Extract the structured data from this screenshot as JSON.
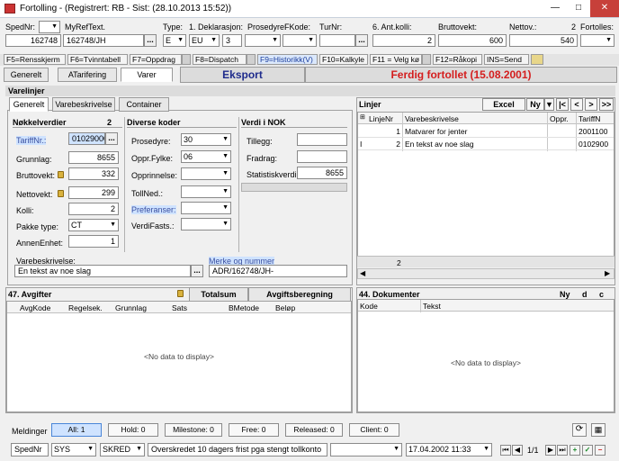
{
  "window": {
    "title": "Fortolling - (Registrert: RB - Sist: (28.10.2013 15:52))",
    "min_glyph": "—",
    "max_glyph": "□",
    "close_glyph": "✕"
  },
  "header": {
    "labels": {
      "spednr": "SpedNr:",
      "myref": "MyRefText.",
      "type": "Type:",
      "deklarasjon": "1. Deklarasjon:",
      "prosedyre": "Prosedyre:",
      "fkode": "FKode:",
      "turnr": "TurNr:",
      "antkolli": "6. Ant.kolli:",
      "bruttovekt": "Bruttovekt:",
      "nettov": "Nettov.:",
      "fortolles": "Fortolles:",
      "fortolles_num": "2"
    },
    "values": {
      "spednr": "162748",
      "myref": "162748/JH",
      "type": "E",
      "dekl_a": "EU",
      "dekl_b": "3",
      "antkolli": "2",
      "bruttovekt": "600",
      "nettov": "540"
    },
    "ellipsis": "..."
  },
  "fkeys": [
    "F5=Rensskjerm",
    "F6=Tvinntabell",
    "F7=Oppdrag",
    "F8=Dispatch",
    "F9=Historikk(V)",
    "F10=Kalkyle",
    "F11 = Velg kø",
    "F12=Råkopi",
    "INS=Send"
  ],
  "main_tabs": {
    "generelt": "Generelt",
    "atarifering": "ATarifering",
    "varer": "Varer"
  },
  "banners": {
    "eksport": "Eksport",
    "ferdig": "Ferdig fortollet (15.08.2001)"
  },
  "varelinjer": {
    "title": "Varelinjer",
    "tabs": {
      "generelt": "Generelt",
      "varebeskrivelse": "Varebeskrivelse",
      "container": "Container"
    },
    "nokkelverdier": {
      "title": "Nøkkelverdier",
      "count": "2",
      "labels": {
        "tariffnr": "TariffNr.:",
        "grunnlag": "Grunnlag:",
        "bruttovekt": "Bruttovekt:",
        "nettovekt": "Nettovekt:",
        "kolli": "Kolli:",
        "pakketype": "Pakke type:",
        "annenenhet": "AnnenEnhet:"
      },
      "values": {
        "tariffnr": "01029000",
        "grunnlag": "8655",
        "bruttovekt": "332",
        "nettovekt": "299",
        "kolli": "2",
        "pakketype": "CT",
        "annenenhet": "1"
      }
    },
    "diverse": {
      "title": "Diverse koder",
      "labels": {
        "prosedyre": "Prosedyre:",
        "opprfylke": "Oppr.Fylke:",
        "opprinnelse": "Opprinnelse:",
        "tollned": "TollNed.:",
        "preferanser": "Preferanser:",
        "verdifasts": "VerdiFasts.:"
      },
      "values": {
        "prosedyre": "30",
        "opprfylke": "06"
      }
    },
    "verdi": {
      "title": "Verdi i NOK",
      "labels": {
        "tillegg": "Tillegg:",
        "fradrag": "Fradrag:",
        "statistisk": "Statistiskverdi:"
      },
      "values": {
        "statistisk": "8655"
      }
    },
    "varebeskrivelse_label": "Varebeskrivelse:",
    "varebeskrivelse_value": "En tekst av noe slag",
    "merke_label": "Merke og nummer",
    "merke_value": "ADR/162748/JH-"
  },
  "linjer": {
    "title": "Linjer",
    "toolbar": {
      "excel": "Excel",
      "ny": "Ny",
      "first": "|<",
      "prev": "<",
      "next": ">",
      "last": ">>"
    },
    "columns": [
      "LinjeNr",
      "Varebeskrivelse",
      "Oppr.",
      "TariffN"
    ],
    "rows": [
      {
        "nr": "1",
        "desc": "Matvarer for jenter",
        "oppr": "",
        "tariff": "2001100"
      },
      {
        "nr": "2",
        "desc": "En tekst av noe slag",
        "oppr": "",
        "tariff": "0102900"
      }
    ],
    "row_marker": "I",
    "footer_count": "2"
  },
  "avgifter": {
    "title": "47. Avgifter",
    "totalsum": "Totalsum",
    "avgiftsberegning": "Avgiftsberegning",
    "columns": [
      "AvgKode",
      "Regelsek.",
      "Grunnlag",
      "Sats",
      "BMetode",
      "Beløp"
    ],
    "nodata": "<No data to display>"
  },
  "dokumenter": {
    "title": "44. Dokumenter",
    "flags": [
      "Ny",
      "d",
      "c"
    ],
    "columns": [
      "Kode",
      "Tekst"
    ],
    "nodata": "<No data to display>"
  },
  "meldinger": {
    "label": "Meldinger",
    "buttons": [
      "All: 1",
      "Hold: 0",
      "Milestone: 0",
      "Free: 0",
      "Released: 0",
      "Client: 0"
    ]
  },
  "bottom": {
    "spednr": "SpedNr",
    "sys": "SYS",
    "skred": "SKRED",
    "message": "Overskredet 10 dagers frist pga stengt tollkonto",
    "date": "17.04.2002 11:33",
    "page": "1/1"
  },
  "colors": {
    "ferdig": "#d41e1e",
    "eksport": "#1e2b8c",
    "close": "#c7403a",
    "highlight": "#cfe3ff"
  }
}
